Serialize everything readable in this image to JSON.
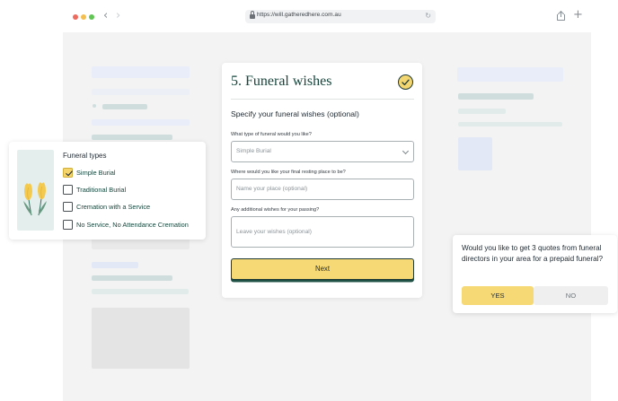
{
  "browser": {
    "url": "https://will.gatheredhere.com.au",
    "back_icon": "‹",
    "forward_icon": "›",
    "reload_icon": "↻",
    "new_tab_icon": "+"
  },
  "form": {
    "title": "5. Funeral wishes",
    "subtitle": "Specify your funeral wishes (optional)",
    "funeral_type_label": "What type of funeral would you like?",
    "funeral_type_value": "Simple Burial",
    "resting_place_label": "Where would you like your final resting place to be?",
    "resting_place_placeholder": "Name your place (optional)",
    "wishes_label": "Any additional wishes for your passing?",
    "wishes_placeholder": "Leave your wishes (optional)",
    "next_label": "Next"
  },
  "funeral_types": {
    "title": "Funeral types",
    "options": [
      {
        "label": "Simple Burial",
        "checked": true
      },
      {
        "label": "Traditional Burial",
        "checked": false
      },
      {
        "label": "Cremation with a Service",
        "checked": false
      },
      {
        "label": "No Service, No Attendance Cremation",
        "checked": false
      }
    ]
  },
  "quote_prompt": {
    "text": "Would you like to get 3 quotes from funeral directors in your area for a prepaid funeral?",
    "yes_label": "YES",
    "no_label": "NO"
  },
  "colors": {
    "accent_yellow": "#f6d874",
    "brand_green": "#17473c",
    "canvas_bg": "#f3f3f3"
  }
}
